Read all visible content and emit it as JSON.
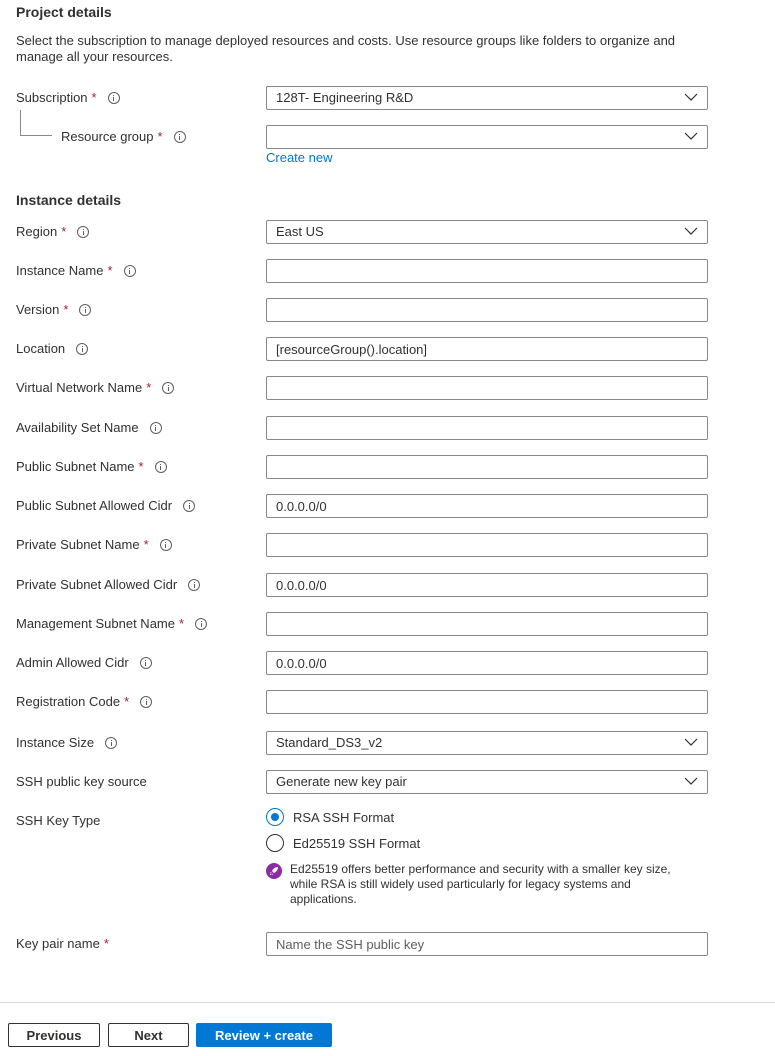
{
  "project": {
    "title": "Project details",
    "description": "Select the subscription to manage deployed resources and costs. Use resource groups like folders to organize and manage all your resources.",
    "subscription": {
      "label": "Subscription",
      "required": "*",
      "value": "128T- Engineering R&D"
    },
    "resource_group": {
      "label": "Resource group",
      "required": "*",
      "value": "",
      "create_new_link": "Create new"
    }
  },
  "instance": {
    "title": "Instance details",
    "region": {
      "label": "Region",
      "required": "*",
      "value": "East US"
    },
    "instance_name": {
      "label": "Instance Name",
      "required": "*",
      "value": ""
    },
    "version": {
      "label": "Version",
      "required": "*",
      "value": ""
    },
    "location": {
      "label": "Location",
      "value": "[resourceGroup().location]"
    },
    "virtual_network_name": {
      "label": "Virtual Network Name",
      "required": "*",
      "value": ""
    },
    "availability_set_name": {
      "label": "Availability Set Name",
      "value": ""
    },
    "public_subnet_name": {
      "label": "Public Subnet Name",
      "required": "*",
      "value": ""
    },
    "public_subnet_allowed_cidr": {
      "label": "Public Subnet Allowed Cidr",
      "value": "0.0.0.0/0"
    },
    "private_subnet_name": {
      "label": "Private Subnet Name",
      "required": "*",
      "value": ""
    },
    "private_subnet_allowed_cidr": {
      "label": "Private Subnet Allowed Cidr",
      "value": "0.0.0.0/0"
    },
    "management_subnet_name": {
      "label": "Management Subnet Name",
      "required": "*",
      "value": ""
    },
    "admin_allowed_cidr": {
      "label": "Admin Allowed Cidr",
      "value": "0.0.0.0/0"
    },
    "registration_code": {
      "label": "Registration Code",
      "required": "*",
      "value": ""
    },
    "instance_size": {
      "label": "Instance Size",
      "value": "Standard_DS3_v2"
    },
    "ssh_key_source": {
      "label": "SSH public key source",
      "value": "Generate new key pair"
    },
    "ssh_key_type": {
      "label": "SSH Key Type",
      "options": [
        {
          "label": "RSA SSH Format",
          "checked": true
        },
        {
          "label": "Ed25519 SSH Format",
          "checked": false
        }
      ],
      "note": "Ed25519 offers better performance and security with a smaller key size, while RSA is still widely used particularly for legacy systems and applications."
    },
    "key_pair_name": {
      "label": "Key pair name",
      "required": "*",
      "value": "",
      "placeholder": "Name the SSH public key"
    }
  },
  "footer": {
    "previous_label": "Previous",
    "next_label": "Next",
    "review_create_label": "Review + create"
  },
  "colors": {
    "accent": "#0078d4",
    "required": "#a4262c",
    "note_icon": "#8a2da5"
  }
}
